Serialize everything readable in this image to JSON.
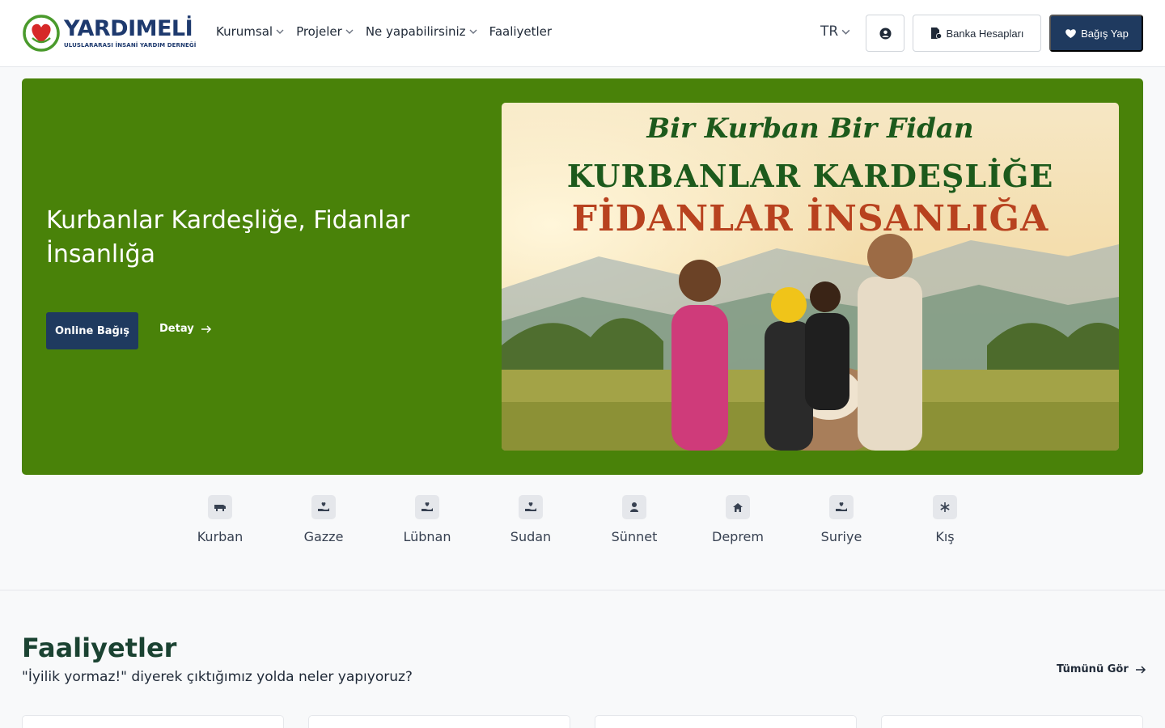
{
  "brand": {
    "name": "YARDIMELİ",
    "tagline": "ULUSLARARASI İNSANİ YARDIM DERNEĞİ",
    "mark_text": "YARDIMELİ",
    "colors": {
      "navy": "#1f3a5f",
      "green": "#498209",
      "red": "#d62828"
    }
  },
  "nav": {
    "items": [
      {
        "label": "Kurumsal",
        "has_dropdown": true
      },
      {
        "label": "Projeler",
        "has_dropdown": true
      },
      {
        "label": "Ne yapabilirsiniz",
        "has_dropdown": true
      },
      {
        "label": "Faaliyetler",
        "has_dropdown": false
      }
    ],
    "language": "TR",
    "user_icon": "user-circle-icon",
    "bank_button": "Banka Hesapları",
    "donate_button": "Bağış Yap"
  },
  "hero": {
    "title": "Kurbanlar Kardeşliğe, Fidanlar İnsanlığa",
    "primary_button": "Online Bağış",
    "detail_link": "Detay",
    "banner": {
      "script_line": "Bir Kurban Bir Fidan",
      "line1": "KURBANLAR KARDEŞLİĞE",
      "line2": "FİDANLAR İNSANLIĞA"
    }
  },
  "categories": [
    {
      "label": "Kurban",
      "icon": "cow-icon"
    },
    {
      "label": "Gazze",
      "icon": "hand-heart-icon"
    },
    {
      "label": "Lübnan",
      "icon": "hand-heart-icon"
    },
    {
      "label": "Sudan",
      "icon": "hand-heart-icon"
    },
    {
      "label": "Sünnet",
      "icon": "child-icon"
    },
    {
      "label": "Deprem",
      "icon": "house-icon"
    },
    {
      "label": "Suriye",
      "icon": "hand-heart-icon"
    },
    {
      "label": "Kış",
      "icon": "snowflake-icon"
    }
  ],
  "activities": {
    "title": "Faaliyetler",
    "subtitle": "\"İyilik yormaz!\" diyerek çıktığımız yolda neler yapıyoruz?",
    "see_all": "Tümünü Gör"
  }
}
